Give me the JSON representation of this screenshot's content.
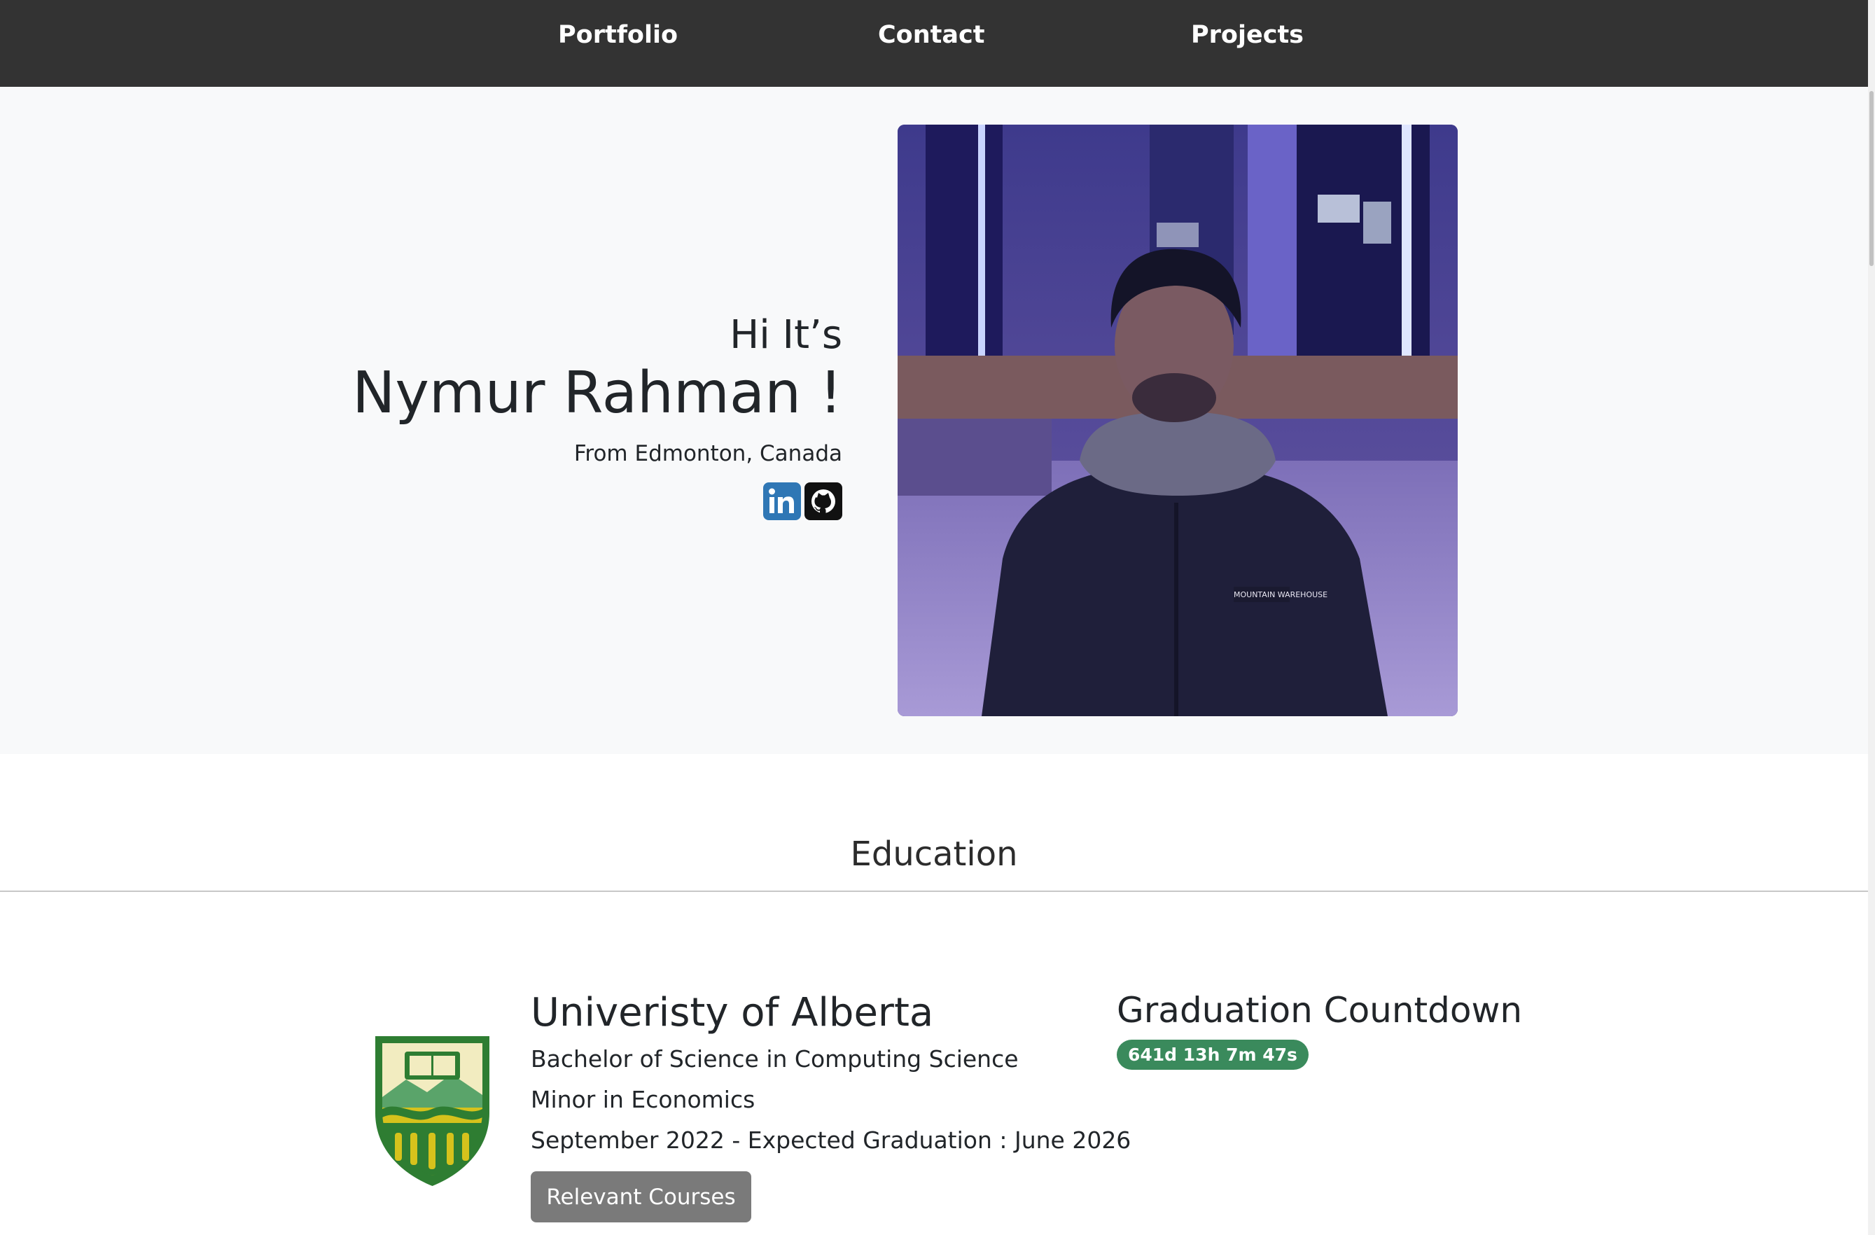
{
  "nav": {
    "items": [
      {
        "label": "Portfolio"
      },
      {
        "label": "Contact"
      },
      {
        "label": "Projects"
      }
    ]
  },
  "hero": {
    "greeting": "Hi It’s",
    "name": "Nymur Rahman !",
    "location": "From Edmonton, Canada",
    "social": [
      "linkedin-icon",
      "github-icon"
    ]
  },
  "education": {
    "title": "Education",
    "university": "Univeristy of Alberta",
    "degree": "Bachelor of Science in Computing Science",
    "minor": "Minor in Economics",
    "dates": "September 2022 - Expected Graduation : June 2026",
    "courses_button": "Relevant Courses"
  },
  "countdown": {
    "title": "Graduation Countdown",
    "value": "641d 13h 7m 47s"
  },
  "photo": {
    "jacket_text": "MOUNTAIN WAREHOUSE"
  },
  "colors": {
    "navbar": "#333333",
    "hero_bg": "#f8f9fa",
    "linkedin": "#2f77b5",
    "github": "#111111",
    "badge": "#3a8a5c",
    "button": "#7a7a7a",
    "ua_green": "#2e7d32",
    "ua_gold": "#d6c21c"
  }
}
